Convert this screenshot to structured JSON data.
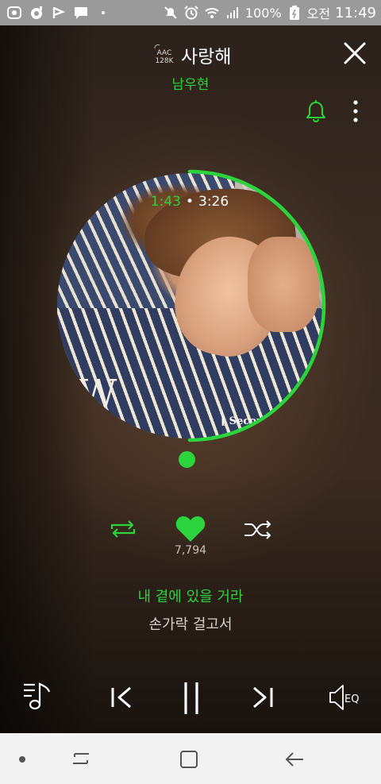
{
  "status_bar": {
    "battery_percent": "100%",
    "time_period": "오전",
    "time": "11:49",
    "icons": [
      "app-icon",
      "record-icon",
      "flag-icon",
      "message-icon",
      "dot-icon",
      "mute-icon",
      "alarm-icon",
      "wifi-icon",
      "signal-icon",
      "battery-icon"
    ]
  },
  "header": {
    "quality_top": "AAC",
    "quality_bottom": "128K",
    "title": "사랑해",
    "artist": "남우현"
  },
  "player": {
    "current_time": "1:43",
    "separator": "•",
    "total_time": "3:26",
    "progress": 0.5,
    "likes": "7,794",
    "lyric_current": "내 곁에 있을 거라",
    "lyric_next": "손가락 걸고서",
    "album_logo_text": "W",
    "album_sub_text": "[ Secon",
    "eq_label": "EQ"
  },
  "colors": {
    "accent": "#2bd33c",
    "status_bar": "#9a9a9a",
    "nav_bar": "#f2f2f2"
  }
}
